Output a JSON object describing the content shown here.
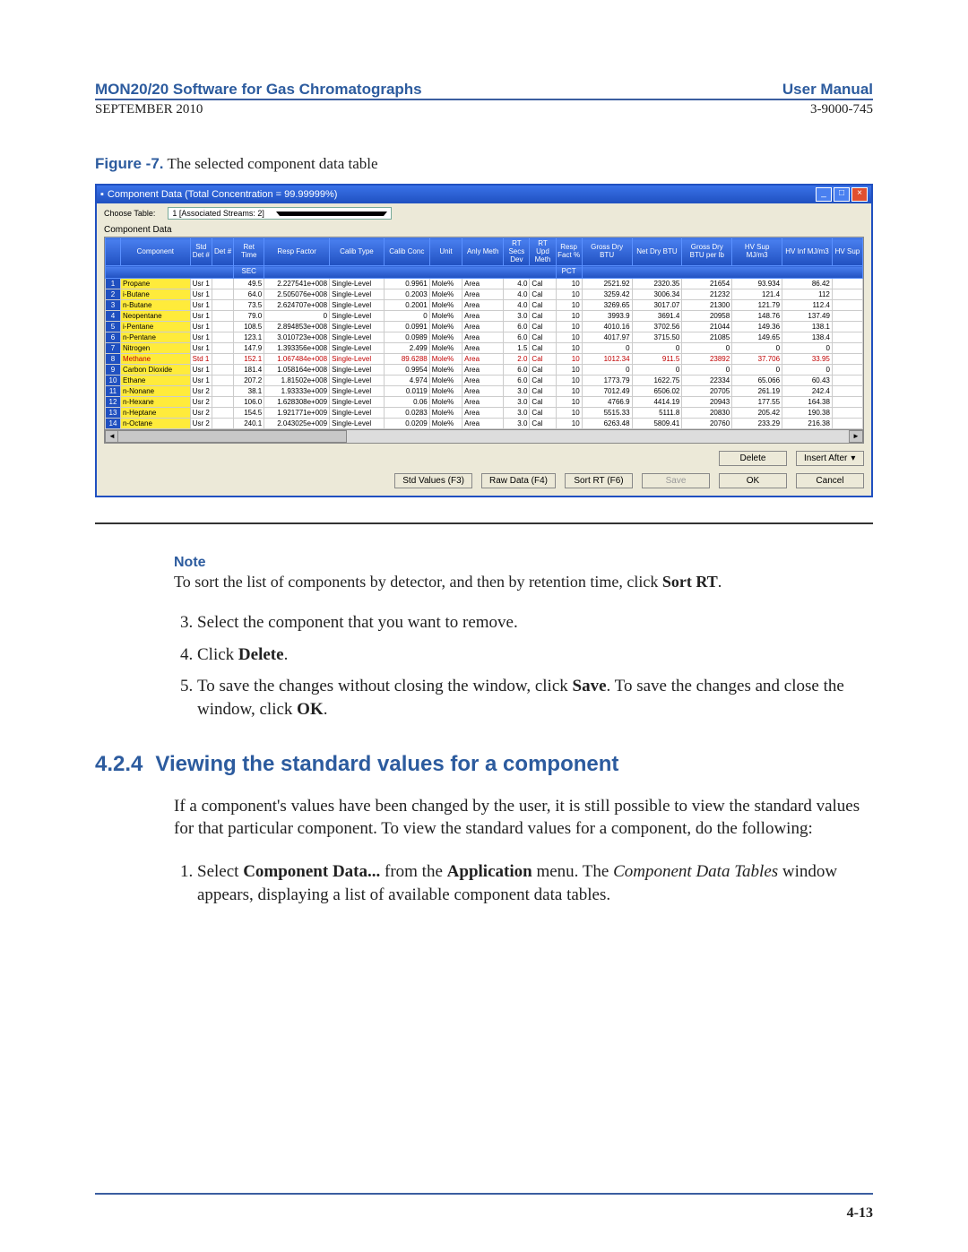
{
  "header": {
    "left": "MON20/20 Software for Gas Chromatographs",
    "right": "User Manual",
    "date": "SEPTEMBER 2010",
    "docnum": "3-9000-745"
  },
  "figure": {
    "label": "Figure -7.",
    "caption": "The selected component data table"
  },
  "window": {
    "title": "Component Data (Total Concentration = 99.99999%)",
    "choose_label": "Choose Table:",
    "choose_value": "1 [Associated Streams: 2]",
    "section": "Component Data",
    "headers": [
      "",
      "Component",
      "Std Det #",
      "Det #",
      "Ret Time",
      "Resp Factor",
      "Calib Type",
      "Calib Conc",
      "Unit",
      "Anly Meth",
      "RT Secs Dev",
      "RT Upd Meth",
      "Resp Fact %",
      "Gross Dry BTU",
      "Net Dry BTU",
      "Gross Dry BTU per lb",
      "HV Sup MJ/m3",
      "HV Inf MJ/m3",
      "HV Sup"
    ],
    "sub": "SEC",
    "rows": [
      {
        "i": 1,
        "c": "Propane",
        "d": "Usr 1",
        "rt": "49.5",
        "rf": "2.227541e+008",
        "ct": "Single-Level",
        "cc": "0.9961",
        "u": "Mole%",
        "am": "Area",
        "sd": "4.0",
        "um": "Cal",
        "rp": "10",
        "g": "2521.92",
        "n": "2320.35",
        "gp": "21654",
        "hs": "93.934",
        "hi": "86.42"
      },
      {
        "i": 2,
        "c": "i-Butane",
        "d": "Usr 1",
        "rt": "64.0",
        "rf": "2.505076e+008",
        "ct": "Single-Level",
        "cc": "0.2003",
        "u": "Mole%",
        "am": "Area",
        "sd": "4.0",
        "um": "Cal",
        "rp": "10",
        "g": "3259.42",
        "n": "3006.34",
        "gp": "21232",
        "hs": "121.4",
        "hi": "112"
      },
      {
        "i": 3,
        "c": "n-Butane",
        "d": "Usr 1",
        "rt": "73.5",
        "rf": "2.624707e+008",
        "ct": "Single-Level",
        "cc": "0.2001",
        "u": "Mole%",
        "am": "Area",
        "sd": "4.0",
        "um": "Cal",
        "rp": "10",
        "g": "3269.65",
        "n": "3017.07",
        "gp": "21300",
        "hs": "121.79",
        "hi": "112.4"
      },
      {
        "i": 4,
        "c": "Neopentane",
        "d": "Usr 1",
        "rt": "79.0",
        "rf": "0",
        "ct": "Single-Level",
        "cc": "0",
        "u": "Mole%",
        "am": "Area",
        "sd": "3.0",
        "um": "Cal",
        "rp": "10",
        "g": "3993.9",
        "n": "3691.4",
        "gp": "20958",
        "hs": "148.76",
        "hi": "137.49"
      },
      {
        "i": 5,
        "c": "i-Pentane",
        "d": "Usr 1",
        "rt": "108.5",
        "rf": "2.894853e+008",
        "ct": "Single-Level",
        "cc": "0.0991",
        "u": "Mole%",
        "am": "Area",
        "sd": "6.0",
        "um": "Cal",
        "rp": "10",
        "g": "4010.16",
        "n": "3702.56",
        "gp": "21044",
        "hs": "149.36",
        "hi": "138.1"
      },
      {
        "i": 6,
        "c": "n-Pentane",
        "d": "Usr 1",
        "rt": "123.1",
        "rf": "3.010723e+008",
        "ct": "Single-Level",
        "cc": "0.0989",
        "u": "Mole%",
        "am": "Area",
        "sd": "6.0",
        "um": "Cal",
        "rp": "10",
        "g": "4017.97",
        "n": "3715.50",
        "gp": "21085",
        "hs": "149.65",
        "hi": "138.4"
      },
      {
        "i": 7,
        "c": "Nitrogen",
        "d": "Usr 1",
        "rt": "147.9",
        "rf": "1.393356e+008",
        "ct": "Single-Level",
        "cc": "2.499",
        "u": "Mole%",
        "am": "Area",
        "sd": "1.5",
        "um": "Cal",
        "rp": "10",
        "g": "0",
        "n": "0",
        "gp": "0",
        "hs": "0",
        "hi": "0"
      },
      {
        "i": 8,
        "c": "Methane",
        "d": "Std 1",
        "rt": "152.1",
        "rf": "1.067484e+008",
        "ct": "Single-Level",
        "cc": "89.6288",
        "u": "Mole%",
        "am": "Area",
        "sd": "2.0",
        "um": "Cal",
        "rp": "10",
        "g": "1012.34",
        "n": "911.5",
        "gp": "23892",
        "hs": "37.706",
        "hi": "33.95",
        "red": true
      },
      {
        "i": 9,
        "c": "Carbon Dioxide",
        "d": "Usr 1",
        "rt": "181.4",
        "rf": "1.058164e+008",
        "ct": "Single-Level",
        "cc": "0.9954",
        "u": "Mole%",
        "am": "Area",
        "sd": "6.0",
        "um": "Cal",
        "rp": "10",
        "g": "0",
        "n": "0",
        "gp": "0",
        "hs": "0",
        "hi": "0"
      },
      {
        "i": 10,
        "c": "Ethane",
        "d": "Usr 1",
        "rt": "207.2",
        "rf": "1.81502e+008",
        "ct": "Single-Level",
        "cc": "4.974",
        "u": "Mole%",
        "am": "Area",
        "sd": "6.0",
        "um": "Cal",
        "rp": "10",
        "g": "1773.79",
        "n": "1622.75",
        "gp": "22334",
        "hs": "65.066",
        "hi": "60.43"
      },
      {
        "i": 11,
        "c": "n-Nonane",
        "d": "Usr 2",
        "rt": "38.1",
        "rf": "1.93333e+009",
        "ct": "Single-Level",
        "cc": "0.0119",
        "u": "Mole%",
        "am": "Area",
        "sd": "3.0",
        "um": "Cal",
        "rp": "10",
        "g": "7012.49",
        "n": "6506.02",
        "gp": "20705",
        "hs": "261.19",
        "hi": "242.4"
      },
      {
        "i": 12,
        "c": "n-Hexane",
        "d": "Usr 2",
        "rt": "106.0",
        "rf": "1.628308e+009",
        "ct": "Single-Level",
        "cc": "0.06",
        "u": "Mole%",
        "am": "Area",
        "sd": "3.0",
        "um": "Cal",
        "rp": "10",
        "g": "4766.9",
        "n": "4414.19",
        "gp": "20943",
        "hs": "177.55",
        "hi": "164.38"
      },
      {
        "i": 13,
        "c": "n-Heptane",
        "d": "Usr 2",
        "rt": "154.5",
        "rf": "1.921771e+009",
        "ct": "Single-Level",
        "cc": "0.0283",
        "u": "Mole%",
        "am": "Area",
        "sd": "3.0",
        "um": "Cal",
        "rp": "10",
        "g": "5515.33",
        "n": "5111.8",
        "gp": "20830",
        "hs": "205.42",
        "hi": "190.38"
      },
      {
        "i": 14,
        "c": "n-Octane",
        "d": "Usr 2",
        "rt": "240.1",
        "rf": "2.043025e+009",
        "ct": "Single-Level",
        "cc": "0.0209",
        "u": "Mole%",
        "am": "Area",
        "sd": "3.0",
        "um": "Cal",
        "rp": "10",
        "g": "6263.48",
        "n": "5809.41",
        "gp": "20760",
        "hs": "233.29",
        "hi": "216.38"
      }
    ],
    "buttons": {
      "delete": "Delete",
      "insert": "Insert After",
      "std": "Std Values (F3)",
      "raw": "Raw Data (F4)",
      "sort": "Sort RT (F6)",
      "save": "Save",
      "ok": "OK",
      "cancel": "Cancel"
    }
  },
  "note": {
    "label": "Note",
    "text_a": "To sort the list of components by detector, and then by retention time, click ",
    "text_b": "Sort RT",
    "text_c": "."
  },
  "steps": {
    "s3": "Select the component that you want to remove.",
    "s4a": "Click ",
    "s4b": "Delete",
    "s4c": ".",
    "s5a": "To save the changes without closing the window, click ",
    "s5b": "Save",
    "s5c": ". To save the changes and close the window, click ",
    "s5d": "OK",
    "s5e": "."
  },
  "section": {
    "num": "4.2.4",
    "title": "Viewing the standard values for a component"
  },
  "para": "If a component's values have been changed by the user, it is still possible to view the standard values for that particular component.  To view the standard values for a component, do the following:",
  "step1": {
    "a": "Select ",
    "b": "Component Data...",
    "c": " from the ",
    "d": "Application",
    "e": " menu.  The ",
    "f": "Component Data Tables",
    "g": " window appears, displaying a list of available component data tables."
  },
  "page": "4-13"
}
